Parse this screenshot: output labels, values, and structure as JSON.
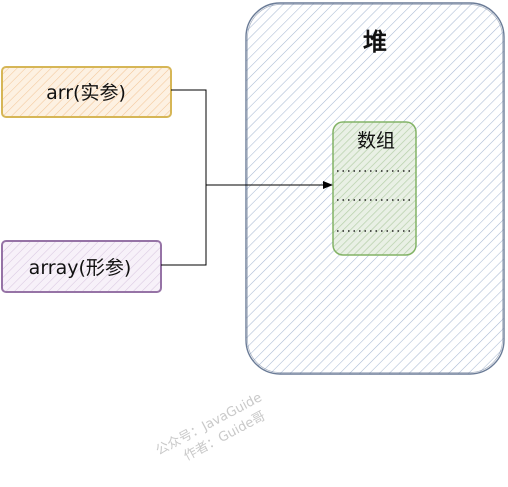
{
  "heap": {
    "label": "堆",
    "fill": "#a9b9d3",
    "stroke": "#6b7c97"
  },
  "array_block": {
    "label": "数组",
    "fill": "#c9d8c2",
    "stroke": "#82b366",
    "slot_divider": "#222222"
  },
  "params": [
    {
      "label": "arr(实参)",
      "fill": "#f7d8b1",
      "stroke": "#d6b656"
    },
    {
      "label": "array(形参)",
      "fill": "#e3d6e8",
      "stroke": "#9673a6"
    }
  ],
  "watermark": {
    "line1": "公众号：JavaGuide",
    "line2": "作者：Guide哥"
  }
}
